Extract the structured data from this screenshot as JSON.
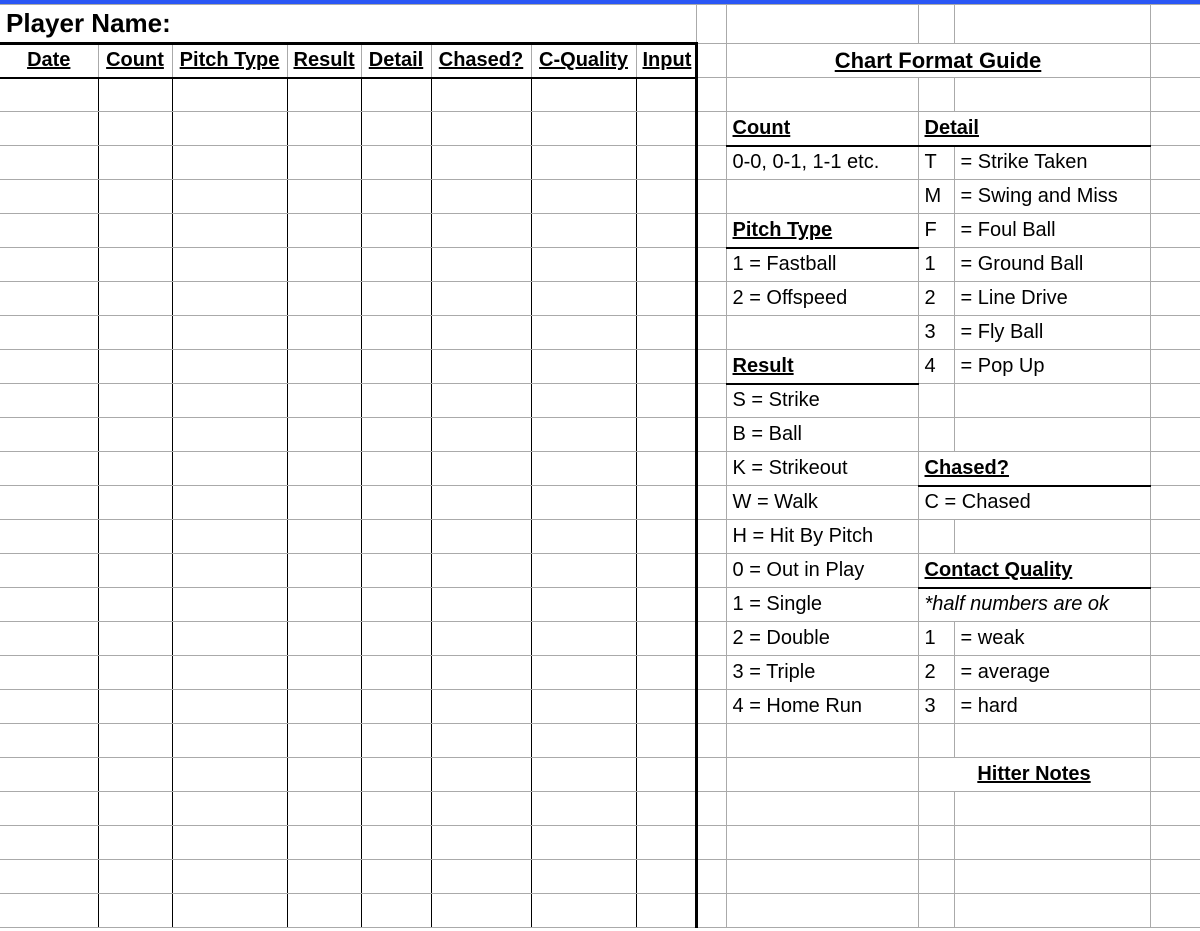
{
  "title": "Player Name:",
  "columns": {
    "date": "Date",
    "count": "Count",
    "pitch_type": "Pitch Type",
    "result": "Result",
    "detail": "Detail",
    "chased": "Chased?",
    "c_quality": "C-Quality",
    "input": "Input"
  },
  "guide": {
    "title": "Chart Format Guide",
    "count": {
      "label": "Count",
      "items": [
        "0-0, 0-1, 1-1 etc."
      ]
    },
    "pitch_type": {
      "label": "Pitch Type",
      "items": [
        "1 = Fastball",
        "2 = Offspeed"
      ]
    },
    "result": {
      "label": "Result",
      "items": [
        "S = Strike",
        "B = Ball",
        "K = Strikeout",
        "W = Walk",
        "H = Hit By Pitch",
        "0 = Out in Play",
        "1 = Single",
        "2 = Double",
        "3 = Triple",
        "4 = Home Run"
      ]
    },
    "detail": {
      "label": "Detail",
      "items": [
        {
          "code": "T",
          "text": "= Strike Taken"
        },
        {
          "code": "M",
          "text": "= Swing and Miss"
        },
        {
          "code": "F",
          "text": "= Foul Ball"
        },
        {
          "code": "1",
          "text": "= Ground Ball"
        },
        {
          "code": "2",
          "text": "= Line Drive"
        },
        {
          "code": "3",
          "text": "= Fly Ball"
        },
        {
          "code": "4",
          "text": "= Pop Up"
        }
      ]
    },
    "chased": {
      "label": "Chased?",
      "items": [
        "C = Chased"
      ]
    },
    "contact_quality": {
      "label": "Contact Quality",
      "note": "*half numbers are ok",
      "items": [
        {
          "code": "1",
          "text": "= weak"
        },
        {
          "code": "2",
          "text": "= average"
        },
        {
          "code": "3",
          "text": "= hard"
        }
      ]
    },
    "hitter_notes": "Hitter Notes"
  },
  "entry_rows": 25
}
